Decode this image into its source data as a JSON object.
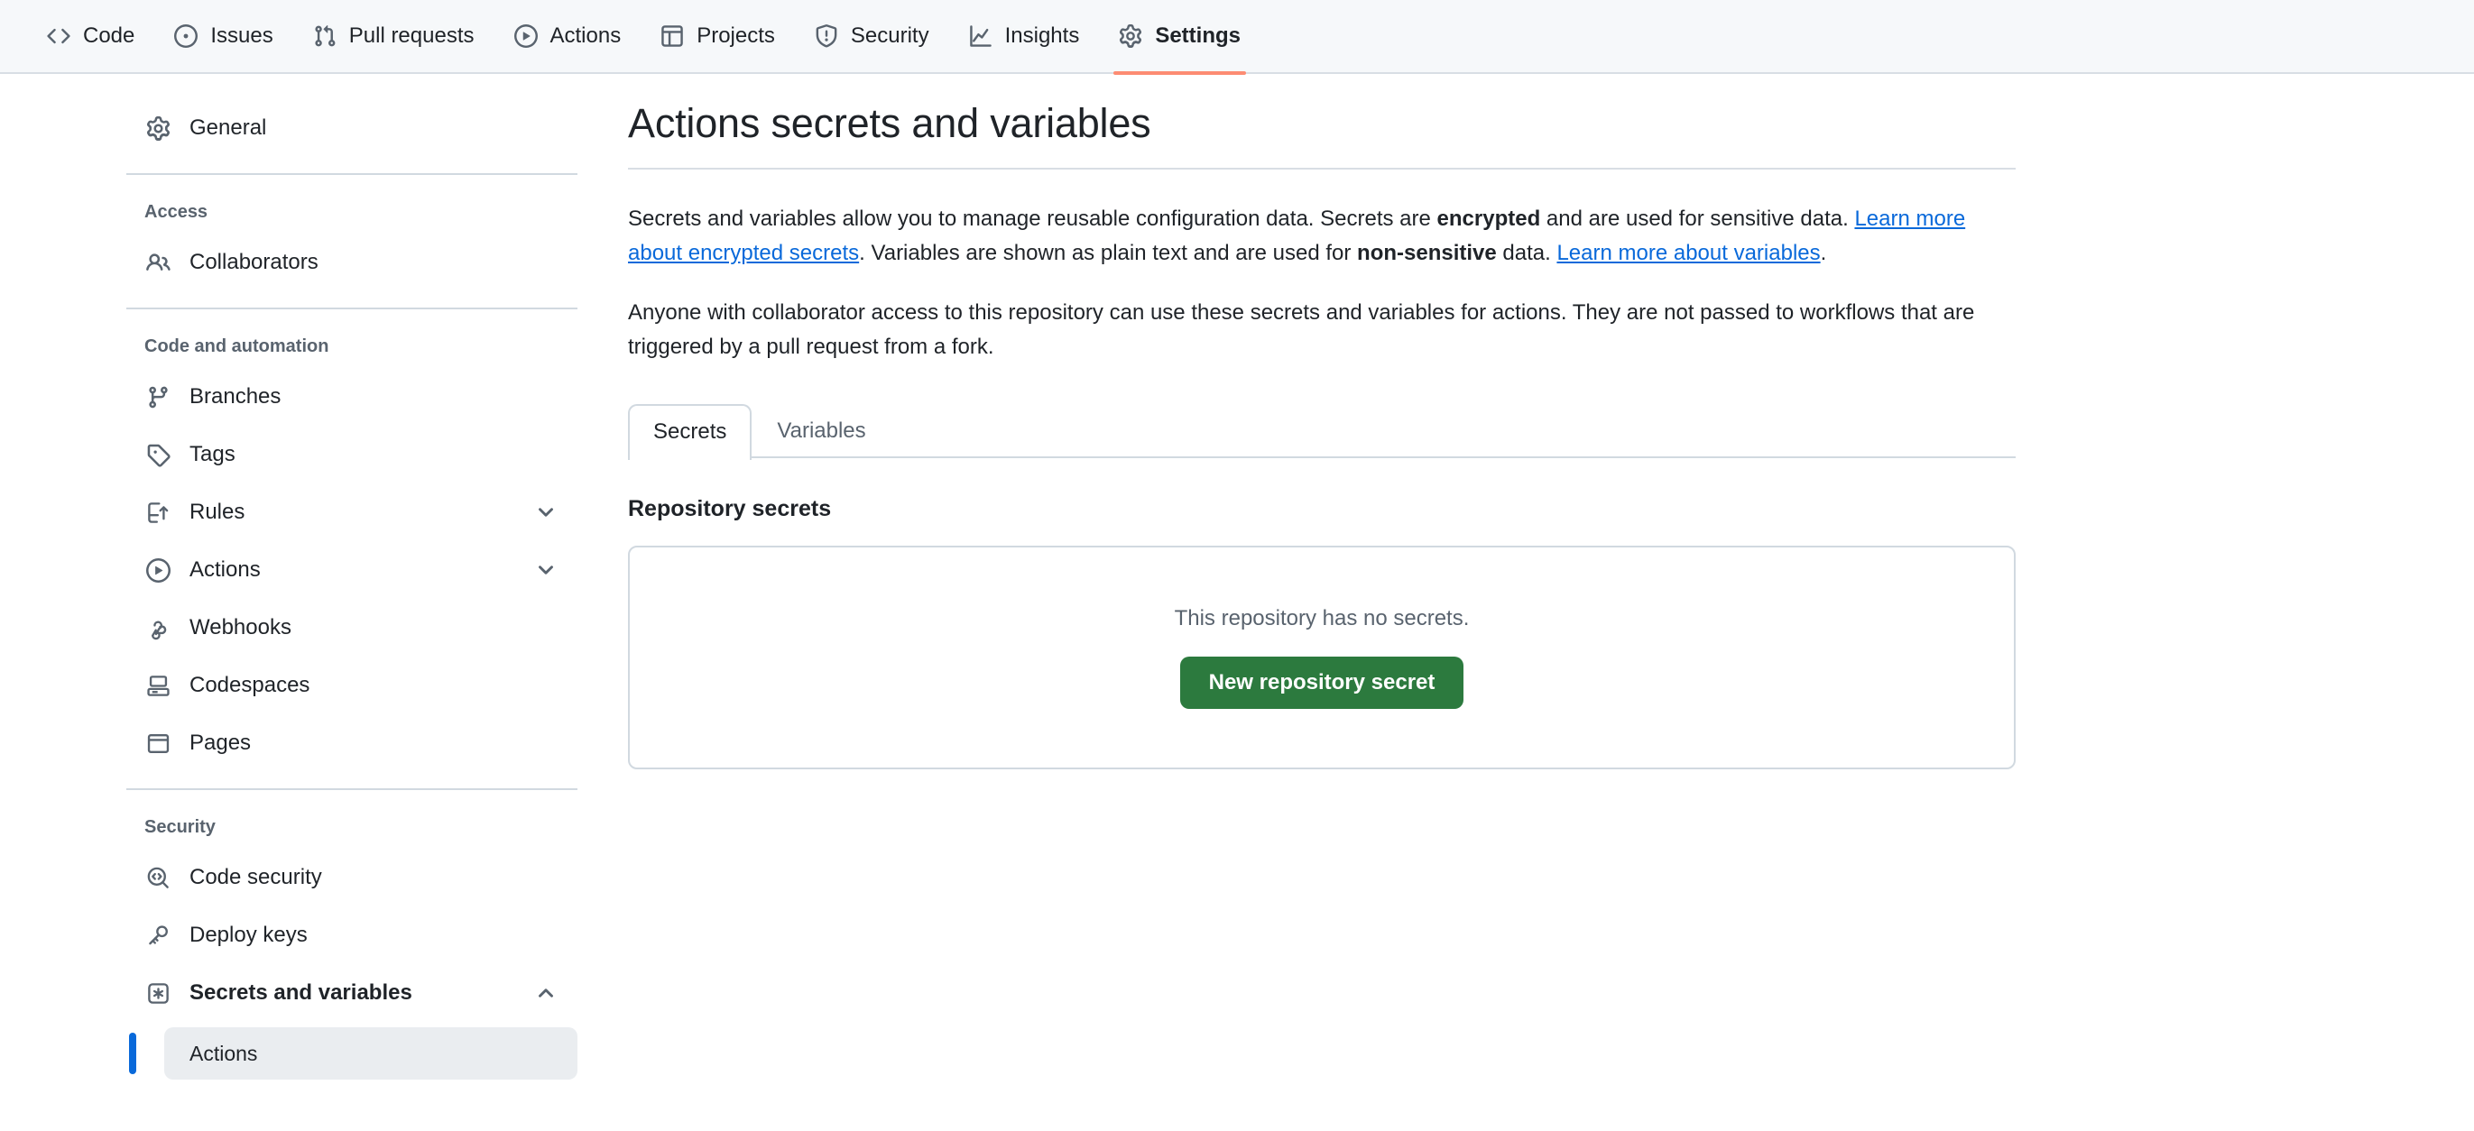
{
  "repo_nav": {
    "tabs": [
      {
        "label": "Code",
        "icon": "code-icon",
        "active": false
      },
      {
        "label": "Issues",
        "icon": "issue-opened-icon",
        "active": false
      },
      {
        "label": "Pull requests",
        "icon": "git-pull-request-icon",
        "active": false
      },
      {
        "label": "Actions",
        "icon": "play-icon",
        "active": false
      },
      {
        "label": "Projects",
        "icon": "table-icon",
        "active": false
      },
      {
        "label": "Security",
        "icon": "shield-icon",
        "active": false
      },
      {
        "label": "Insights",
        "icon": "graph-icon",
        "active": false
      },
      {
        "label": "Settings",
        "icon": "gear-icon",
        "active": true
      }
    ],
    "active_indicator_color": "#fd8c73"
  },
  "sidebar": {
    "general": {
      "label": "General",
      "icon": "gear-icon"
    },
    "sections": [
      {
        "title": "Access",
        "items": [
          {
            "label": "Collaborators",
            "icon": "people-icon",
            "chevron": null
          }
        ]
      },
      {
        "title": "Code and automation",
        "items": [
          {
            "label": "Branches",
            "icon": "git-branch-icon",
            "chevron": null
          },
          {
            "label": "Tags",
            "icon": "tag-icon",
            "chevron": null
          },
          {
            "label": "Rules",
            "icon": "rules-icon",
            "chevron": "chevron-down-icon"
          },
          {
            "label": "Actions",
            "icon": "play-icon",
            "chevron": "chevron-down-icon"
          },
          {
            "label": "Webhooks",
            "icon": "webhook-icon",
            "chevron": null
          },
          {
            "label": "Codespaces",
            "icon": "codespaces-icon",
            "chevron": null
          },
          {
            "label": "Pages",
            "icon": "browser-icon",
            "chevron": null
          }
        ]
      },
      {
        "title": "Security",
        "items": [
          {
            "label": "Code security",
            "icon": "code-security-icon",
            "chevron": null
          },
          {
            "label": "Deploy keys",
            "icon": "key-icon",
            "chevron": null
          },
          {
            "label": "Secrets and variables",
            "icon": "asterisk-box-icon",
            "chevron": "chevron-up-icon",
            "bold": true
          }
        ]
      }
    ],
    "active_sub_item": {
      "label": "Actions",
      "indicator_color": "#0969da"
    }
  },
  "main": {
    "title": "Actions secrets and variables",
    "paragraph1": {
      "part1": "Secrets and variables allow you to manage reusable configuration data. Secrets are ",
      "bold1": "encrypted",
      "part2": " and are used for sensitive data. ",
      "link1": "Learn more about encrypted secrets",
      "part3": ". Variables are shown as plain text and are used for ",
      "bold2": "non-sensitive",
      "part4": " data. ",
      "link2": "Learn more about variables",
      "part5": "."
    },
    "paragraph2": "Anyone with collaborator access to this repository can use these secrets and variables for actions. They are not passed to workflows that are triggered by a pull request from a fork.",
    "tabs": [
      {
        "label": "Secrets",
        "active": true
      },
      {
        "label": "Variables",
        "active": false
      }
    ],
    "section_heading": "Repository secrets",
    "empty_state": {
      "message": "This repository has no secrets.",
      "button_label": "New repository secret",
      "button_color": "#2c7a3e"
    }
  }
}
